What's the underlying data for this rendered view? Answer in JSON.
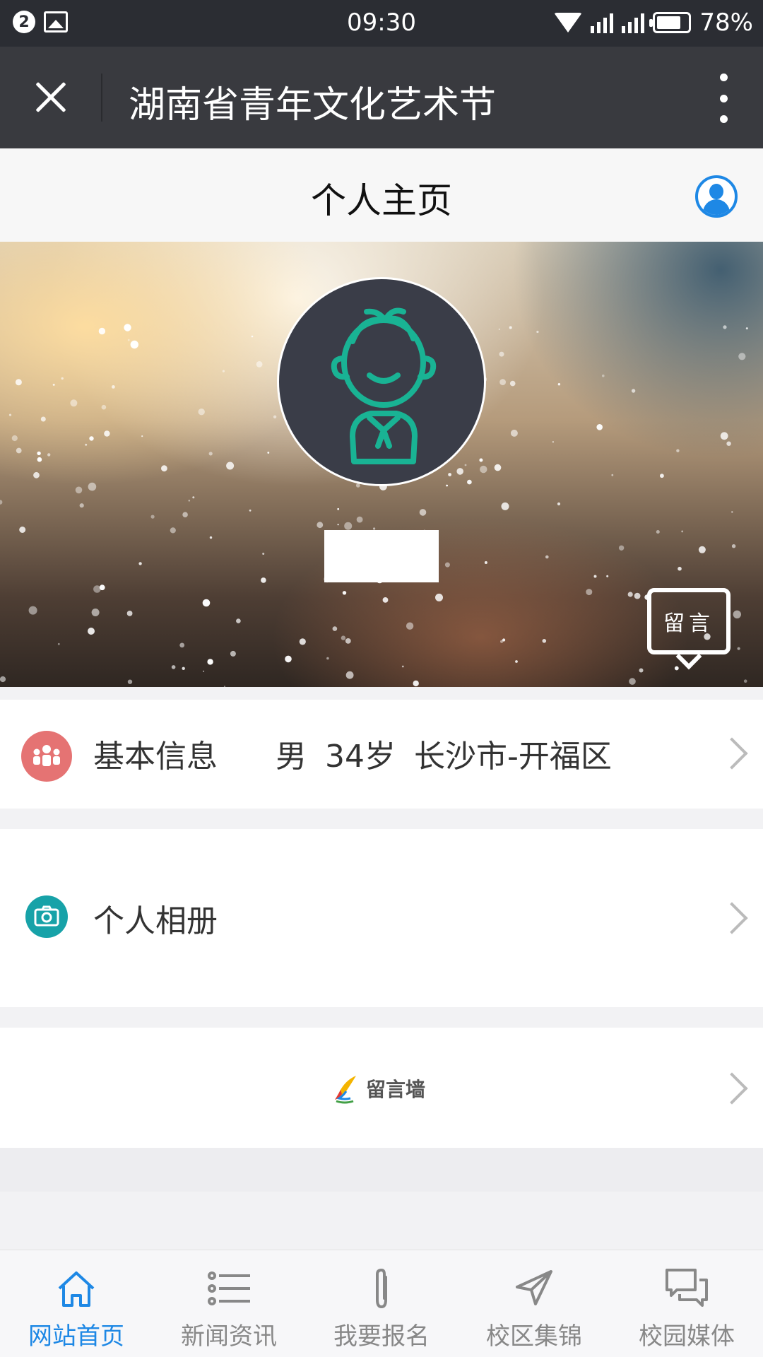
{
  "status_bar": {
    "notification_count": "2",
    "time": "09:30",
    "battery": "78%"
  },
  "title_bar": {
    "title": "湖南省青年文化艺术节"
  },
  "page_header": {
    "title": "个人主页"
  },
  "hero": {
    "message_button": "留言"
  },
  "basic_info": {
    "label": "基本信息",
    "gender": "男",
    "age": "34岁",
    "location": "长沙市-开福区"
  },
  "album": {
    "label": "个人相册"
  },
  "message_wall": {
    "label": "留言墙"
  },
  "bottom_nav": {
    "items": [
      {
        "label": "网站首页",
        "icon": "home-icon",
        "active": true
      },
      {
        "label": "新闻资讯",
        "icon": "list-icon",
        "active": false
      },
      {
        "label": "我要报名",
        "icon": "paperclip-icon",
        "active": false
      },
      {
        "label": "校区集锦",
        "icon": "send-icon",
        "active": false
      },
      {
        "label": "校园媒体",
        "icon": "chat-icon",
        "active": false
      }
    ]
  },
  "colors": {
    "accent": "#1e88e5",
    "title_bar": "#393a3f",
    "status_bar": "#2b2d33"
  }
}
